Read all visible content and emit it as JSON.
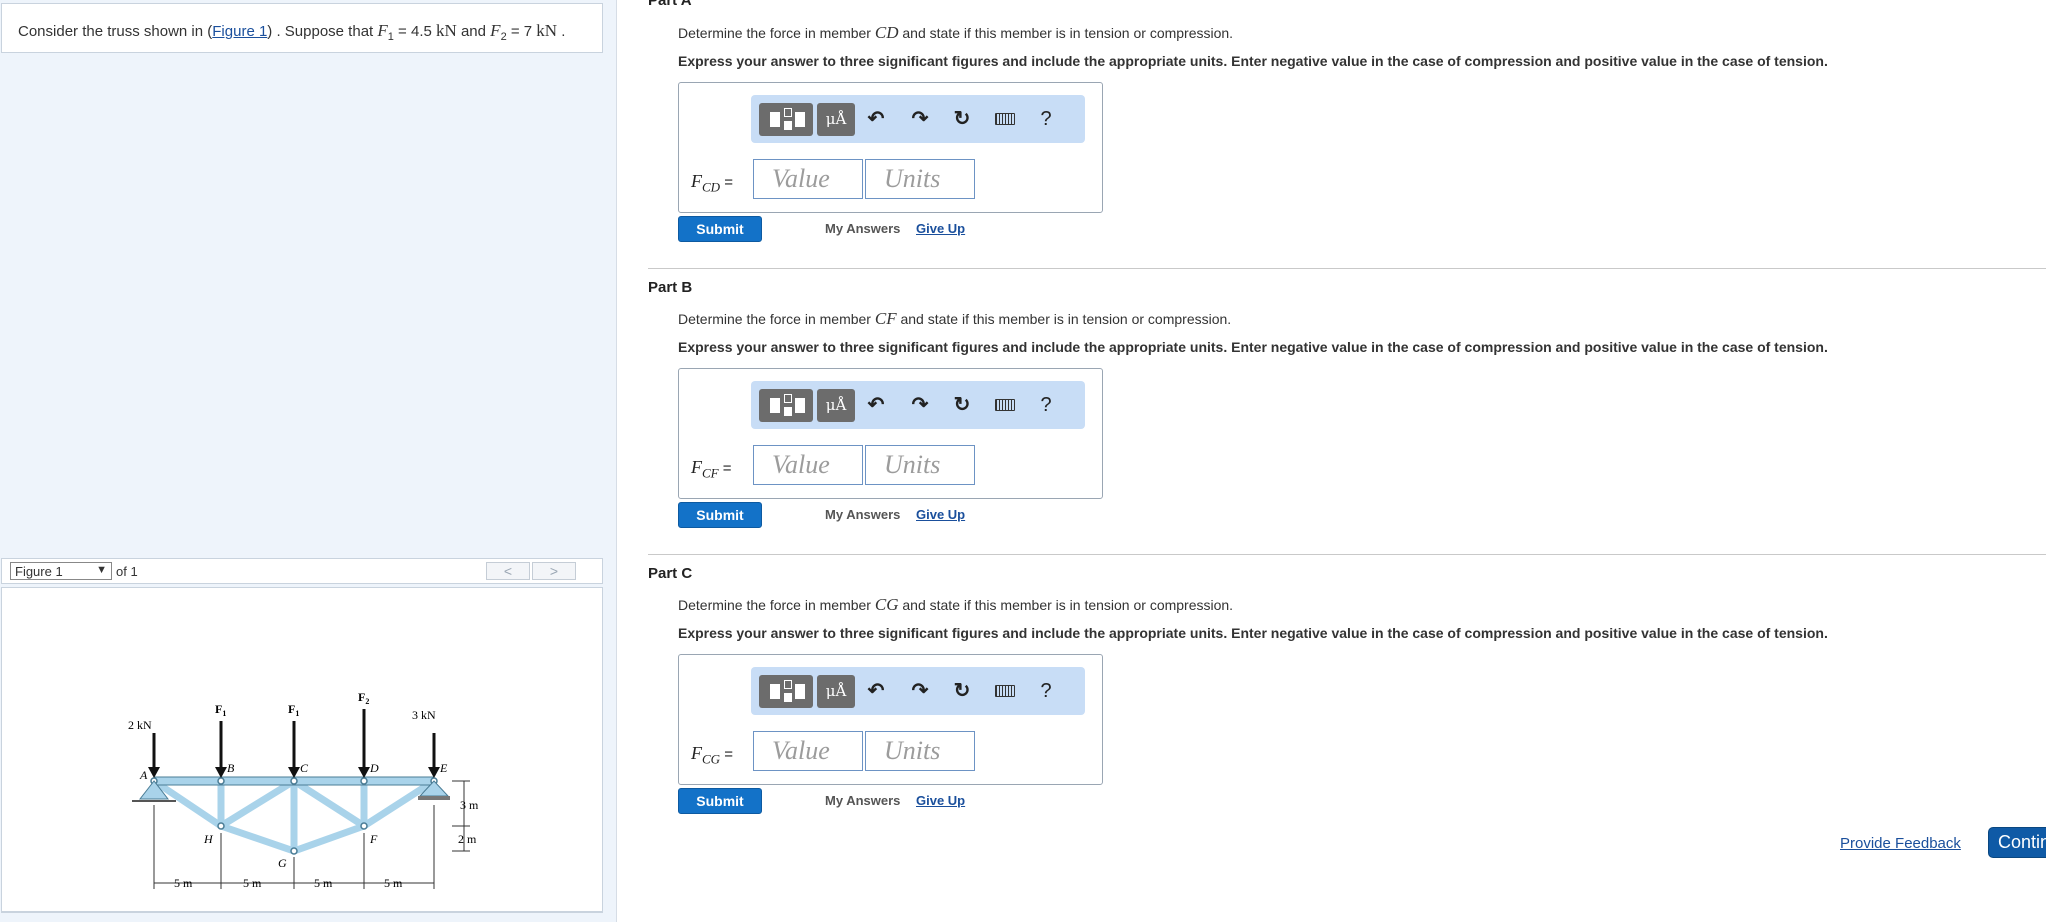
{
  "problem": {
    "pre": "Consider the truss shown in (",
    "figure_link": "Figure 1",
    "post": ") . Suppose that ",
    "f1_sym": "F",
    "f1_sub": "1",
    "f1_eq": " = 4.5 ",
    "f1_unit": "kN",
    "and": " and ",
    "f2_sym": "F",
    "f2_sub": "2",
    "f2_eq": " = 7 ",
    "f2_unit": "kN",
    "end": " ."
  },
  "figure": {
    "selector": "Figure 1",
    "selector_arrow": "▼",
    "of_label": "of 1",
    "prev": "<",
    "next": ">",
    "labels": {
      "load_a": "2 kN",
      "load_e": "3 kN",
      "f1": "F",
      "f1_sub": "1",
      "f2": "F",
      "f2_sub": "2",
      "A": "A",
      "B": "B",
      "C": "C",
      "D": "D",
      "E": "E",
      "F": "F",
      "G": "G",
      "H": "H",
      "dim_3m": "3 m",
      "dim_2m": "2 m",
      "span": "5 m"
    }
  },
  "parts": [
    {
      "title": "Part A",
      "q_pre": "Determine the force in member ",
      "member": "CD",
      "q_post": " and state if this member is in tension or compression.",
      "instructions": "Express your answer to three significant figures and include the appropriate units. Enter negative value in the case of compression and positive value in the case of tension.",
      "label_main": "F",
      "label_sub": "CD",
      "label_eq": " =",
      "value_placeholder": "Value",
      "units_placeholder": "Units"
    },
    {
      "title": "Part B",
      "q_pre": "Determine the force in member ",
      "member": "CF",
      "q_post": " and state if this member is in tension or compression.",
      "instructions": "Express your answer to three significant figures and include the appropriate units. Enter negative value in the case of compression and positive value in the case of tension.",
      "label_main": "F",
      "label_sub": "CF",
      "label_eq": " =",
      "value_placeholder": "Value",
      "units_placeholder": "Units"
    },
    {
      "title": "Part C",
      "q_pre": "Determine the force in member ",
      "member": "CG",
      "q_post": " and state if this member is in tension or compression.",
      "instructions": "Express your answer to three significant figures and include the appropriate units. Enter negative value in the case of compression and positive value in the case of tension.",
      "label_main": "F",
      "label_sub": "CG",
      "label_eq": " =",
      "value_placeholder": "Value",
      "units_placeholder": "Units"
    }
  ],
  "toolbar": {
    "mu_label": "μÅ",
    "undo": "↶",
    "redo": "↷",
    "reset": "↻",
    "help": "?"
  },
  "buttons": {
    "submit": "Submit",
    "my_answers": "My Answers",
    "give_up": "Give Up"
  },
  "footer": {
    "feedback": "Provide Feedback",
    "continue": "Continue"
  },
  "colors": {
    "accent": "#1372c8",
    "truss": "#a9d3ea",
    "panel_bg": "#eef4fb",
    "toolbar_bg": "#c8ddf6"
  }
}
